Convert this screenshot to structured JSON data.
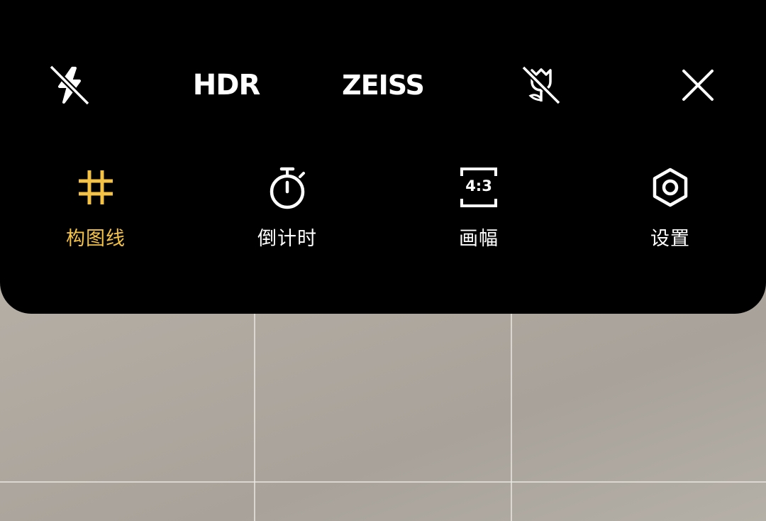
{
  "top_bar": {
    "flash": {
      "icon": "flash-off-icon"
    },
    "hdr_label": "HDR",
    "zeiss_label": "ZEISS",
    "macro": {
      "icon": "macro-off-icon"
    },
    "close": {
      "icon": "close-icon"
    }
  },
  "tools": [
    {
      "label": "构图线",
      "icon": "grid-lines-icon",
      "active": true
    },
    {
      "label": "倒计时",
      "icon": "timer-icon",
      "active": false
    },
    {
      "label": "画幅",
      "icon": "aspect-ratio-icon",
      "icon_text": "4:3",
      "active": false
    },
    {
      "label": "设置",
      "icon": "settings-icon",
      "active": false
    }
  ],
  "colors": {
    "panel_bg": "#000000",
    "active": "#f4c244",
    "inactive": "#ffffff"
  }
}
